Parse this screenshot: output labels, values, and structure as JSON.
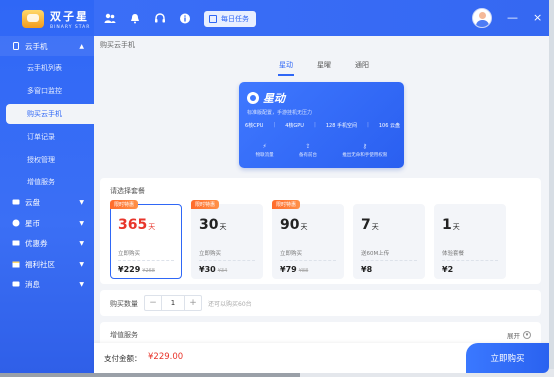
{
  "app": {
    "logo_cn": "双子星",
    "logo_en": "BINARY STAR"
  },
  "sidebar": {
    "groups": [
      {
        "label": "云手机",
        "expanded": true,
        "icon": "phone-icon"
      },
      {
        "label": "云盘",
        "icon": "disk-icon"
      },
      {
        "label": "星币",
        "icon": "coin-icon"
      },
      {
        "label": "优惠券",
        "icon": "coupon-icon"
      },
      {
        "label": "福利社区",
        "icon": "gift-icon"
      },
      {
        "label": "消息",
        "icon": "message-icon"
      }
    ],
    "sub_items": [
      "云手机列表",
      "多窗口监控",
      "购买云手机",
      "订单记录",
      "授权管理",
      "增值服务"
    ],
    "active_sub": "购买云手机"
  },
  "titlebar": {
    "daily_task": "每日任务",
    "minimize": "—",
    "close": "×"
  },
  "breadcrumb": "购买云手机",
  "tabs": [
    "星动",
    "星曜",
    "通阳"
  ],
  "active_tab": "星动",
  "hero": {
    "name": "星动",
    "desc": "标准版配置，手游挂机无压力",
    "specs": [
      "6核CPU",
      "4核GPU",
      "128 手机空间",
      "106 云盘"
    ],
    "features": [
      "物联流量",
      "备有前台",
      "推出无命和手使用权限"
    ]
  },
  "packages": {
    "label": "请选择套餐",
    "promo_label": "限时特惠",
    "items": [
      {
        "days": "365",
        "unit": "天",
        "sub": "立即购买",
        "price": "¥229",
        "orig": "¥268",
        "promo": true,
        "selected": true
      },
      {
        "days": "30",
        "unit": "天",
        "sub": "立即购买",
        "price": "¥30",
        "orig": "¥34",
        "promo": true,
        "selected": false
      },
      {
        "days": "90",
        "unit": "天",
        "sub": "立即购买",
        "price": "¥79",
        "orig": "¥88",
        "promo": true,
        "selected": false
      },
      {
        "days": "7",
        "unit": "天",
        "sub": "送60M上传",
        "price": "¥8",
        "orig": "",
        "promo": false,
        "selected": false
      },
      {
        "days": "1",
        "unit": "天",
        "sub": "体验套餐",
        "price": "¥2",
        "orig": "",
        "promo": false,
        "selected": false
      }
    ]
  },
  "quantity": {
    "label": "购买数量",
    "value": "1",
    "minus": "−",
    "plus": "+",
    "hint": "还可以购买60台"
  },
  "value_added": {
    "label": "增值服务",
    "expand": "展开"
  },
  "payment": {
    "label": "支付金额：",
    "amount": "¥229.00",
    "buy_button": "立即购买"
  },
  "colors": {
    "brand": "#2f67f6",
    "price_red": "#e8352b",
    "promo_orange": "#ff6b2c"
  }
}
